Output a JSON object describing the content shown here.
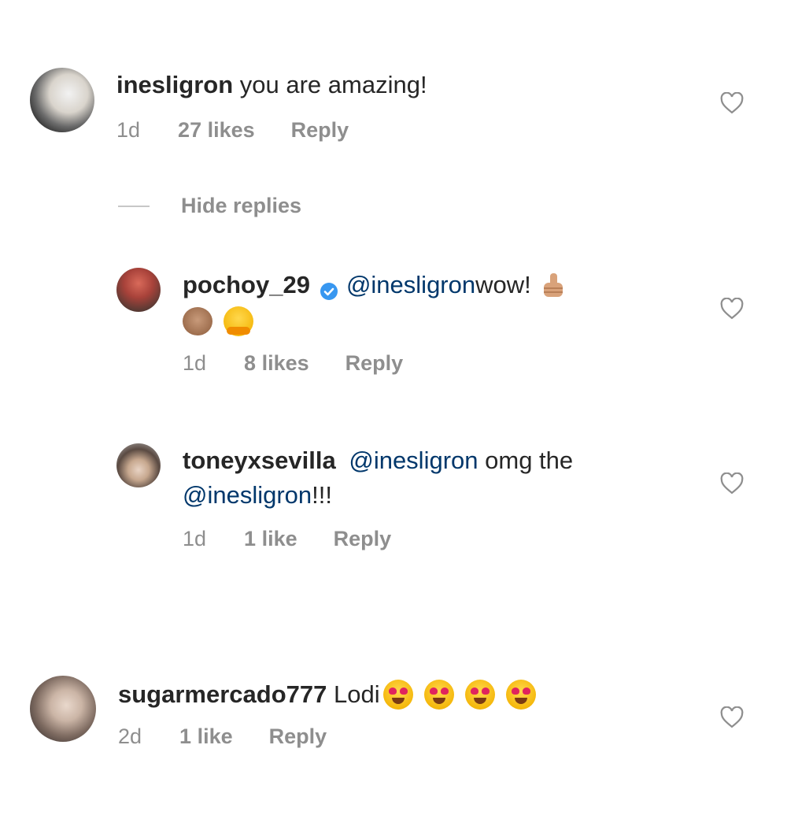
{
  "comments": [
    {
      "username": "inesligron",
      "text": " you are amazing!",
      "time": "1d",
      "likes": "27 likes",
      "reply": "Reply"
    },
    {
      "username": "pochoy_29",
      "mention": "@inesligron",
      "text": " wow!",
      "time": "1d",
      "likes": "8 likes",
      "reply": "Reply"
    },
    {
      "username": "toneyxsevilla",
      "mention": "@inesligron",
      "text": " omg the",
      "mention2": "@inesligron",
      "text2": "!!!",
      "time": "1d",
      "likes": "1 like",
      "reply": "Reply"
    },
    {
      "username": "sugarmercado777",
      "text": " Lodi",
      "time": "2d",
      "likes": "1 like",
      "reply": "Reply"
    }
  ],
  "hide_replies": "Hide replies",
  "colors": {
    "text": "#262626",
    "muted": "#8e8e8e",
    "mention": "#00376b",
    "verified": "#3897f0"
  },
  "icons": {
    "like": "heart-outline-icon",
    "verified": "verified-badge-icon"
  }
}
